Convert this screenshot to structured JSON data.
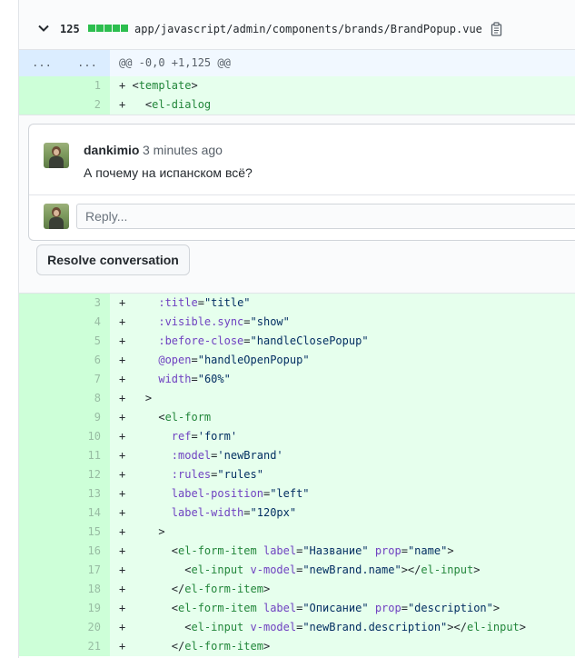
{
  "file": {
    "diffstat": "125",
    "path": "app/javascript/admin/components/brands/BrandPopup.vue"
  },
  "hunk": {
    "old_marker": "...",
    "new_marker": "...",
    "header": "@@ -0,0 +1,125 @@"
  },
  "lines_top": [
    {
      "num": "1",
      "code": "+ <template>"
    },
    {
      "num": "2",
      "code": "+   <el-dialog"
    }
  ],
  "comment": {
    "author": "dankimio",
    "time": "3 minutes ago",
    "text": "А почему на испанском всё?",
    "reply_placeholder": "Reply...",
    "resolve_label": "Resolve conversation"
  },
  "lines_bottom": [
    {
      "num": "3",
      "code": "+     :title=\"title\""
    },
    {
      "num": "4",
      "code": "+     :visible.sync=\"show\""
    },
    {
      "num": "5",
      "code": "+     :before-close=\"handleClosePopup\""
    },
    {
      "num": "6",
      "code": "+     @open=\"handleOpenPopup\""
    },
    {
      "num": "7",
      "code": "+     width=\"60%\""
    },
    {
      "num": "8",
      "code": "+   >"
    },
    {
      "num": "9",
      "code": "+     <el-form"
    },
    {
      "num": "10",
      "code": "+       ref='form'"
    },
    {
      "num": "11",
      "code": "+       :model='newBrand'"
    },
    {
      "num": "12",
      "code": "+       :rules=\"rules\""
    },
    {
      "num": "13",
      "code": "+       label-position=\"left\""
    },
    {
      "num": "14",
      "code": "+       label-width=\"120px\""
    },
    {
      "num": "15",
      "code": "+     >"
    },
    {
      "num": "16",
      "code": "+       <el-form-item label=\"Название\" prop=\"name\">"
    },
    {
      "num": "17",
      "code": "+         <el-input v-model=\"newBrand.name\"></el-input>"
    },
    {
      "num": "18",
      "code": "+       </el-form-item>"
    },
    {
      "num": "19",
      "code": "+       <el-form-item label=\"Описание\" prop=\"description\">"
    },
    {
      "num": "20",
      "code": "+         <el-input v-model=\"newBrand.description\"></el-input>"
    },
    {
      "num": "21",
      "code": "+       </el-form-item>"
    }
  ],
  "icons": {
    "collapse": "chevron-down-icon",
    "copy": "clipboard-icon"
  },
  "colors": {
    "addition_bg": "#e6ffed",
    "addition_num_bg": "#cdffd8",
    "hunk_bg": "#f1f8ff",
    "diffstat_green": "#2cbe4e"
  }
}
